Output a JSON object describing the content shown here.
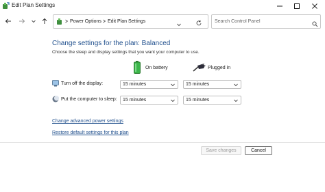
{
  "window": {
    "title": "Edit Plan Settings"
  },
  "nav": {
    "breadcrumbs": [
      "Power Options",
      "Edit Plan Settings"
    ],
    "search_placeholder": "Search Control Panel"
  },
  "content": {
    "heading": "Change settings for the plan: Balanced",
    "subtext": "Choose the sleep and display settings that you want your computer to use.",
    "columns": {
      "on_battery": "On battery",
      "plugged_in": "Plugged in"
    },
    "rows": [
      {
        "label": "Turn off the display:",
        "on_battery": "15 minutes",
        "plugged_in": "15 minutes"
      },
      {
        "label": "Put the computer to sleep:",
        "on_battery": "15 minutes",
        "plugged_in": "15 minutes"
      }
    ],
    "links": {
      "advanced": "Change advanced power settings",
      "restore": "Restore default settings for this plan"
    }
  },
  "footer": {
    "save_label": "Save changes",
    "cancel_label": "Cancel"
  },
  "colors": {
    "accent": "#1e4e8c",
    "battery_green": "#3bb54a"
  }
}
